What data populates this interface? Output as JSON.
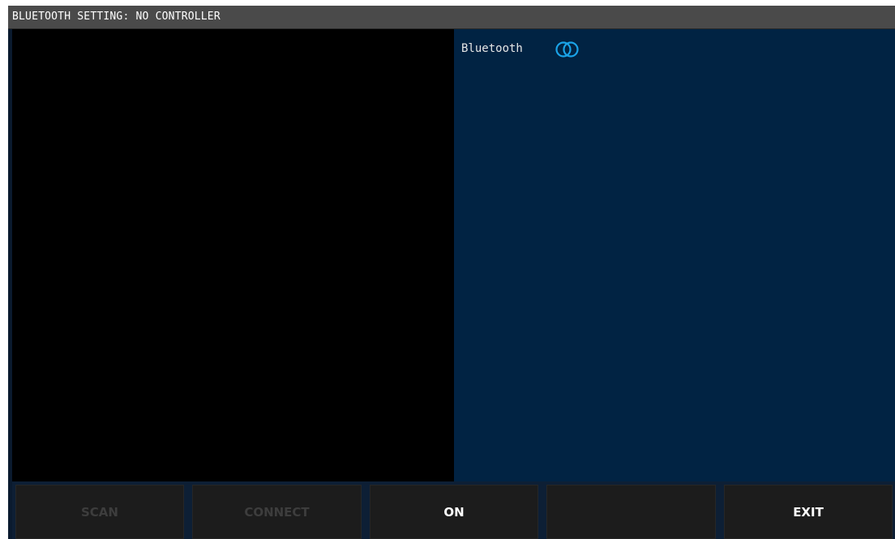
{
  "window": {
    "title": "BLUETOOTH SETTING: NO CONTROLLER"
  },
  "settings": {
    "bluetooth_label": "Bluetooth",
    "bluetooth_toggle_icon": "toggle-icon",
    "toggle_color": "#1aa3e8"
  },
  "colors": {
    "left_pane": "#000000",
    "right_pane": "#012343",
    "titlebar": "#4a4a4a",
    "button_bg": "#1c1c1c",
    "disabled_text": "#3d3d3d"
  },
  "buttons": [
    {
      "label": "SCAN",
      "enabled": false
    },
    {
      "label": "CONNECT",
      "enabled": false
    },
    {
      "label": "ON",
      "enabled": true
    },
    {
      "label": "",
      "enabled": true
    },
    {
      "label": "EXIT",
      "enabled": true
    }
  ]
}
